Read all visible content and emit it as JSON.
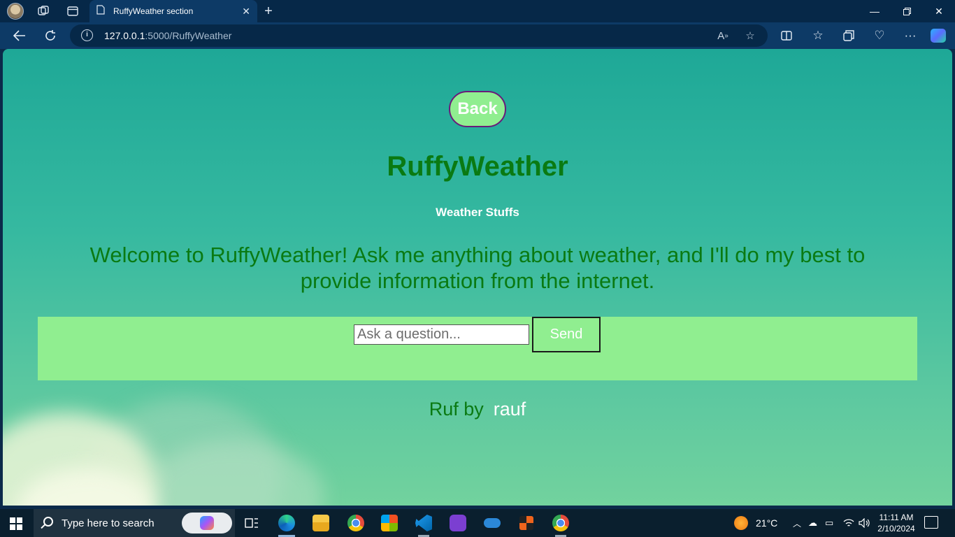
{
  "browser": {
    "tab_title": "RuffyWeather section",
    "url_host": "127.0.0.1",
    "url_rest": ":5000/RuffyWeather",
    "icons": {
      "profile": "profile-avatar-icon",
      "workspaces": "workspaces-icon",
      "tab_actions": "tab-actions-icon",
      "page": "page-icon",
      "close_tab": "close-icon",
      "new_tab": "plus-icon",
      "back": "back-arrow-icon",
      "refresh": "refresh-icon",
      "info": "info-icon",
      "read_aloud": "read-aloud-icon",
      "favorite": "star-icon",
      "split": "split-screen-icon",
      "favorites": "favorites-icon",
      "collections": "collections-icon",
      "health": "browser-essentials-icon",
      "more": "more-icon",
      "copilot": "copilot-icon"
    }
  },
  "page": {
    "back_label": "Back",
    "title": "RuffyWeather",
    "subtitle": "Weather Stuffs",
    "welcome": "Welcome to RuffyWeather! Ask me anything about weather, and I'll do my best to provide information from the internet.",
    "input_placeholder": "Ask a question...",
    "send_label": "Send",
    "footer_prefix": "Ruf by",
    "footer_author": "rauf",
    "colors": {
      "accent_green": "#90ee90",
      "title_green": "#0a7a12",
      "back_border": "#6a1a7a"
    }
  },
  "taskbar": {
    "search_placeholder": "Type here to search",
    "weather_temp": "21°C",
    "time": "11:11 AM",
    "date": "2/10/2024",
    "apps": [
      "task-view-icon",
      "edge-icon",
      "file-explorer-icon",
      "chrome-icon",
      "store-icon",
      "vscode-icon",
      "github-desktop-icon",
      "onedrive-icon",
      "app-icon",
      "chrome-icon"
    ]
  }
}
